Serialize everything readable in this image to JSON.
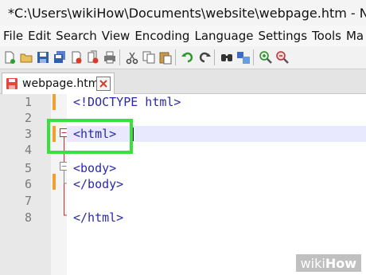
{
  "window": {
    "title": "*C:\\Users\\wikiHow\\Documents\\website\\webpage.htm - Not"
  },
  "menu": [
    "File",
    "Edit",
    "Search",
    "View",
    "Encoding",
    "Language",
    "Settings",
    "Tools",
    "Ma"
  ],
  "toolbar_icons": [
    "new-file-icon",
    "open-file-icon",
    "save-icon",
    "save-all-icon",
    "close-icon",
    "close-all-icon",
    "print-icon",
    "cut-icon",
    "copy-icon",
    "paste-icon",
    "undo-icon",
    "redo-icon",
    "find-icon",
    "replace-icon",
    "zoom-in-icon",
    "zoom-out-icon"
  ],
  "tab": {
    "label": "webpage.htm",
    "status": "modified"
  },
  "editor": {
    "current_line": 3,
    "lines": [
      {
        "num": "1",
        "text": "<!DOCTYPE html>"
      },
      {
        "num": "2",
        "text": ""
      },
      {
        "num": "3",
        "text": "<html>"
      },
      {
        "num": "4",
        "text": ""
      },
      {
        "num": "5",
        "text": "<body>"
      },
      {
        "num": "6",
        "text": "</body>"
      },
      {
        "num": "7",
        "text": ""
      },
      {
        "num": "8",
        "text": "</html>"
      }
    ]
  },
  "watermark": {
    "prefix": "wiki",
    "suffix": "How"
  },
  "colors": {
    "tag": "#2a2aa8",
    "highlight_box": "#3be13b",
    "current_line": "#e8e8ff",
    "change_marker": "#f0a030",
    "tab_disk": "#e8463a"
  }
}
